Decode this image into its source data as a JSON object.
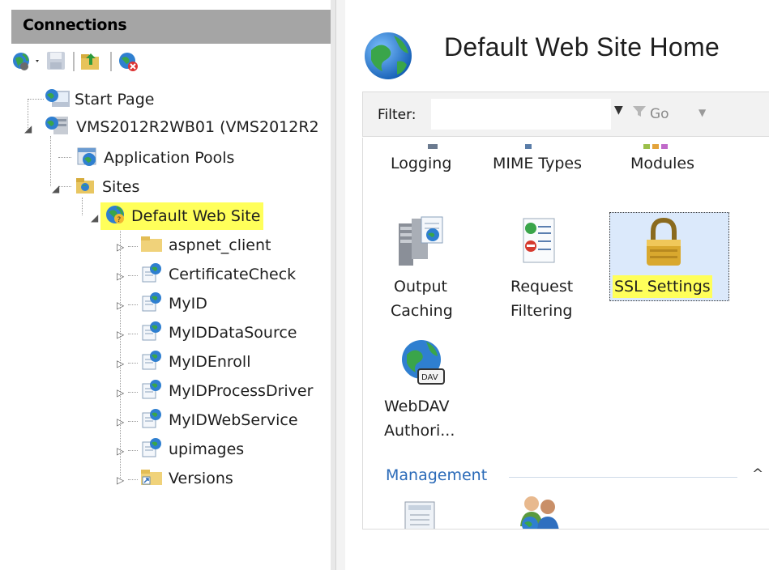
{
  "connections": {
    "title": "Connections",
    "toolbar": [
      {
        "icon": "connect-globe-icon"
      },
      {
        "icon": "save-icon"
      },
      {
        "icon": "up-folder-icon"
      },
      {
        "icon": "disconnect-icon"
      }
    ],
    "tree": {
      "start_page": "Start Page",
      "server": "VMS2012R2WB01 (VMS2012R2",
      "app_pools": "Application Pools",
      "sites": "Sites",
      "default_site": "Default Web Site",
      "children": [
        "aspnet_client",
        "CertificateCheck",
        "MyID",
        "MyIDDataSource",
        "MyIDEnroll",
        "MyIDProcessDriver",
        "MyIDWebService",
        "upimages",
        "Versions"
      ]
    }
  },
  "main": {
    "title": "Default Web Site Home",
    "filter": {
      "label": "Filter:",
      "value": "",
      "go_label": "Go"
    },
    "features": {
      "row1": [
        "Logging",
        "MIME Types",
        "Modules"
      ],
      "output_caching": [
        "Output",
        "Caching"
      ],
      "request_filtering": [
        "Request",
        "Filtering"
      ],
      "ssl_settings": "SSL Settings",
      "webdav": [
        "WebDAV",
        "Authori..."
      ]
    },
    "management_section": "Management"
  },
  "colors": {
    "highlight": "#ffff5a",
    "header_gray": "#a5a5a5",
    "section_blue": "#2a6ab8",
    "selection_blue": "#dbe9fb"
  }
}
